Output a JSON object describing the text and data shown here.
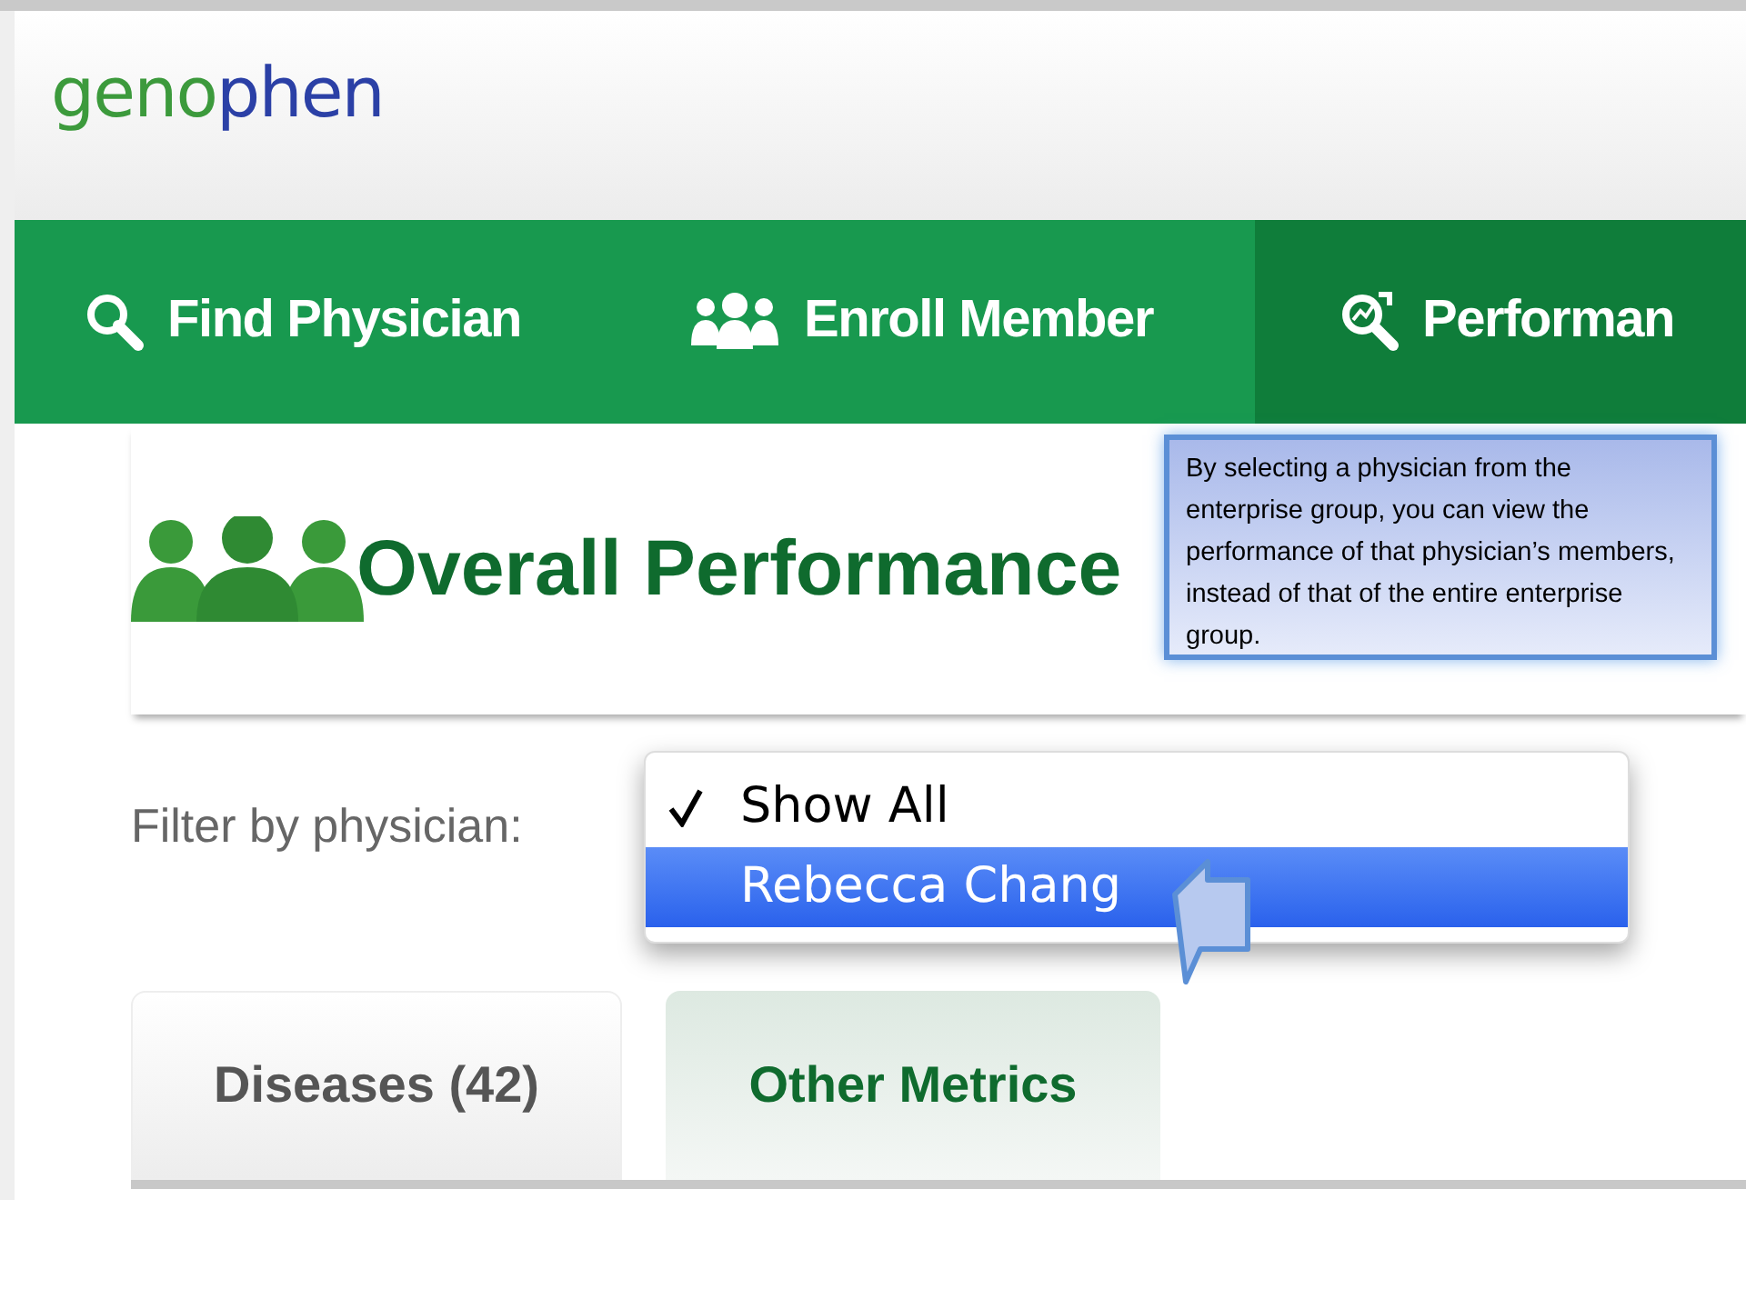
{
  "logo": [
    "geno",
    "phen"
  ],
  "nav": [
    {
      "label": "Find Physician",
      "selected": false
    },
    {
      "label": "Enroll Member",
      "selected": false
    },
    {
      "label": "Performan",
      "selected": true
    }
  ],
  "page_title": "Overall Performance",
  "filter": {
    "label": "Filter by physician:",
    "options": [
      {
        "label": "Show All",
        "checked": true,
        "selected": false
      },
      {
        "label": "Rebecca Chang",
        "checked": false,
        "selected": true
      }
    ]
  },
  "tabs": [
    {
      "label": "Diseases (42)",
      "selected": false
    },
    {
      "label": "Other Metrics",
      "selected": true
    }
  ],
  "callout": "By selecting a physician from the enterprise group, you can view the performance of that physician’s members, instead of that of the entire enterprise group."
}
